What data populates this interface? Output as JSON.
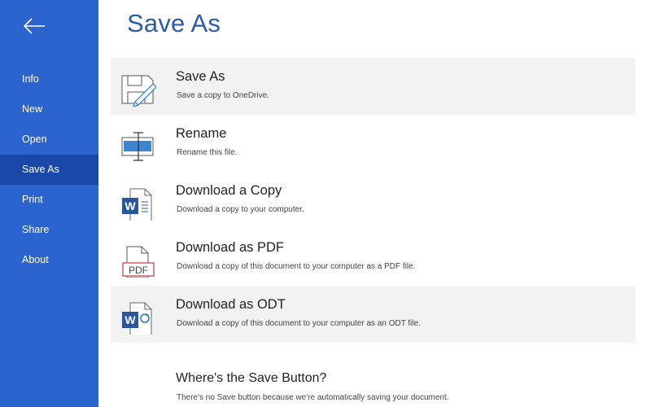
{
  "sidebar": {
    "back_icon": "back-arrow-icon",
    "items": [
      {
        "label": "Info"
      },
      {
        "label": "New"
      },
      {
        "label": "Open"
      },
      {
        "label": "Save As",
        "active": true
      },
      {
        "label": "Print"
      },
      {
        "label": "Share"
      },
      {
        "label": "About"
      }
    ]
  },
  "main": {
    "title": "Save As",
    "options": [
      {
        "title": "Save As",
        "description": "Save a copy to OneDrive.",
        "icon": "save-as-icon"
      },
      {
        "title": "Rename",
        "description": "Rename this file.",
        "icon": "rename-icon"
      },
      {
        "title": "Download a Copy",
        "description": "Download a copy to your computer.",
        "icon": "word-document-icon"
      },
      {
        "title": "Download as PDF",
        "description": "Download a copy of this document to your computer as a PDF file.",
        "icon": "pdf-document-icon"
      },
      {
        "title": "Download as ODT",
        "description": "Download a copy of this document to your computer as an ODT file.",
        "icon": "odt-document-icon"
      }
    ],
    "help": {
      "title": "Where's the Save Button?",
      "description": "There's no Save button because we're automatically saving your document."
    },
    "pdf_icon_text": "PDF"
  },
  "colors": {
    "sidebar_bg": "#2b63cf",
    "sidebar_active": "#1a48a8",
    "title_blue": "#2b5ba8",
    "option_hover_bg": "#f2f2f2",
    "word_blue": "#2b579a",
    "pdf_red": "#c43b3b"
  }
}
